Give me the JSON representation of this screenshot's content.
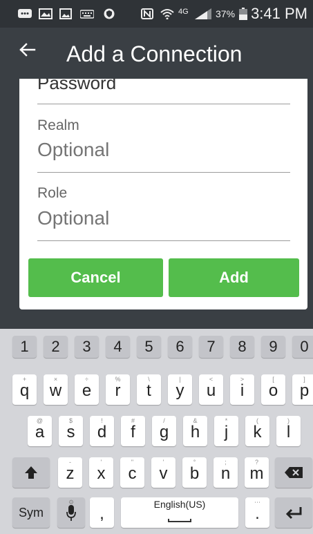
{
  "status_bar": {
    "battery_percent": "37%",
    "network": "4G",
    "time": "3:41 PM",
    "icons": [
      "message-icon",
      "gallery-icon",
      "photo-icon",
      "keyboard-icon",
      "vpn-shield-icon",
      "nfc-icon",
      "wifi-icon",
      "signal-icon",
      "battery-icon"
    ]
  },
  "app_bar": {
    "title": "Add a Connection",
    "back_icon": "arrow-left-icon"
  },
  "dialog": {
    "password_label": "Password",
    "realm": {
      "label": "Realm",
      "placeholder": "Optional",
      "value": ""
    },
    "role": {
      "label": "Role",
      "placeholder": "Optional",
      "value": ""
    },
    "cancel_label": "Cancel",
    "add_label": "Add",
    "button_color": "#54bd4c"
  },
  "keyboard": {
    "numbers": [
      "1",
      "2",
      "3",
      "4",
      "5",
      "6",
      "7",
      "8",
      "9",
      "0"
    ],
    "row1": [
      {
        "k": "q",
        "h": "+"
      },
      {
        "k": "w",
        "h": "×"
      },
      {
        "k": "e",
        "h": "÷"
      },
      {
        "k": "r",
        "h": "%"
      },
      {
        "k": "t",
        "h": "\\"
      },
      {
        "k": "y",
        "h": "|"
      },
      {
        "k": "u",
        "h": "<"
      },
      {
        "k": "i",
        "h": ">"
      },
      {
        "k": "o",
        "h": "["
      },
      {
        "k": "p",
        "h": "]"
      }
    ],
    "row2": [
      {
        "k": "a",
        "h": "@"
      },
      {
        "k": "s",
        "h": "$"
      },
      {
        "k": "d",
        "h": "!"
      },
      {
        "k": "f",
        "h": "#"
      },
      {
        "k": "g",
        "h": "/"
      },
      {
        "k": "h",
        "h": "&"
      },
      {
        "k": "j",
        "h": "*"
      },
      {
        "k": "k",
        "h": "("
      },
      {
        "k": "l",
        "h": ")"
      }
    ],
    "row3": [
      {
        "k": "z",
        "h": "-"
      },
      {
        "k": "x",
        "h": "'"
      },
      {
        "k": "c",
        "h": "\""
      },
      {
        "k": "v",
        "h": "'"
      },
      {
        "k": "b",
        "h": "°"
      },
      {
        "k": "n",
        "h": ";"
      },
      {
        "k": "m",
        "h": "?"
      }
    ],
    "shift_icon": "shift-icon",
    "backspace_icon": "backspace-icon",
    "sym_label": "Sym",
    "mic_icon": "microphone-icon",
    "comma": ",",
    "space_label": "English(US)",
    "period": ".",
    "period_hint": "⋯",
    "enter_icon": "enter-icon"
  }
}
